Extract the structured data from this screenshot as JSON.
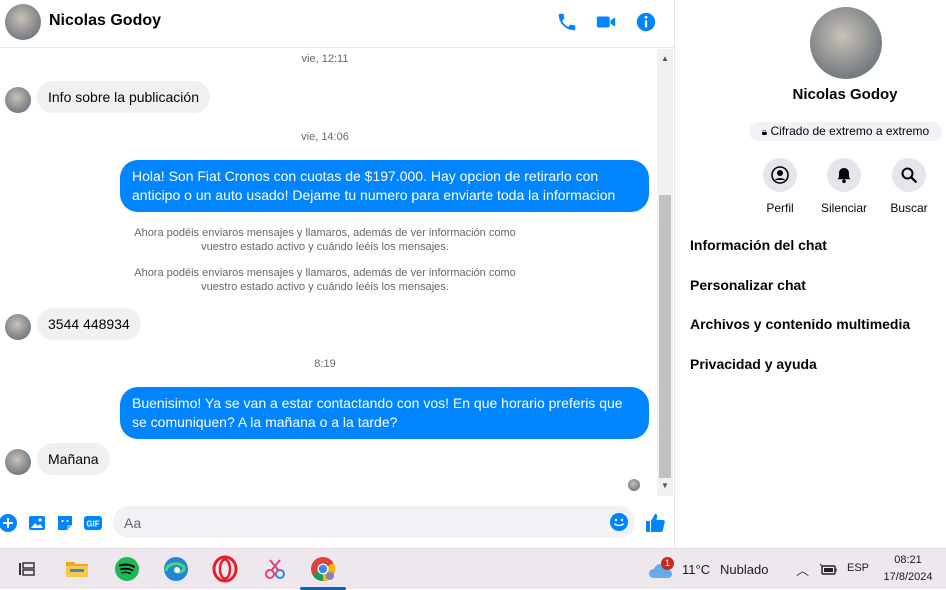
{
  "header": {
    "contact_name": "Nicolas Godoy"
  },
  "conversation": {
    "timestamp_1": "vie, 12:11",
    "msg_in_1": "Info sobre la publicación",
    "timestamp_2": "vie, 14:06",
    "msg_out_1": "Hola! Son Fiat Cronos con cuotas de $197.000. Hay opcion de retirarlo con anticipo o un auto usado! Dejame tu numero para enviarte toda la informacion",
    "system_1_line1": "Ahora podéis enviaros mensajes y llamaros, además de ver información como",
    "system_1_line2": "vuestro estado activo y cuándo leéis los mensajes.",
    "system_2_line1": "Ahora podéis enviaros mensajes y llamaros, además de ver información como",
    "system_2_line2": "vuestro estado activo y cuándo leéis los mensajes.",
    "msg_in_2": "3544 448934",
    "timestamp_3": "8:19",
    "msg_out_2": "Buenisimo! Ya se van a estar contactando con vos! En que horario preferis que se comuniquen? A la mañana o a la tarde?",
    "msg_in_3": "Mañana"
  },
  "composer": {
    "placeholder": "Aa"
  },
  "side_panel": {
    "name": "Nicolas Godoy",
    "encryption": "Cifrado de extremo a extremo",
    "actions": [
      {
        "label": "Perfil",
        "icon": "profile-icon"
      },
      {
        "label": "Silenciar",
        "icon": "bell-icon"
      },
      {
        "label": "Buscar",
        "icon": "search-icon"
      }
    ],
    "menu": [
      "Información del chat",
      "Personalizar chat",
      "Archivos y contenido multimedia",
      "Privacidad y ayuda"
    ]
  },
  "taskbar": {
    "weather_badge": "1",
    "weather_temp": "11°C",
    "weather_desc": "Nublado",
    "language": "ESP",
    "time": "08:21",
    "date": "17/8/2024"
  },
  "colors": {
    "accent": "#0084ff",
    "bubble_in": "#f0f0f0",
    "taskbar": "#efe7ee"
  }
}
